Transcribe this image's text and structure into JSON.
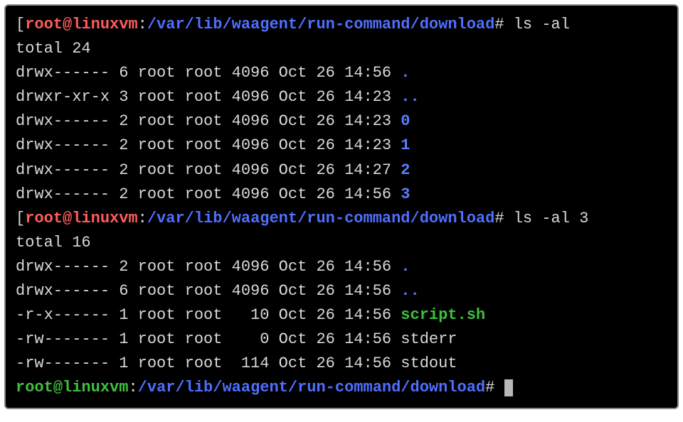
{
  "prompts": [
    {
      "user": "root",
      "at": "@",
      "host": "linuxvm",
      "colon": ":",
      "cwd": "/var/lib/waagent/run-command/download",
      "hash": "#",
      "cmd": "ls -al"
    },
    {
      "user": "root",
      "at": "@",
      "host": "linuxvm",
      "colon": ":",
      "cwd": "/var/lib/waagent/run-command/download",
      "hash": "#",
      "cmd": "ls -al 3"
    },
    {
      "user": "root",
      "at": "@",
      "host": "linuxvm",
      "colon": ":",
      "cwd": "/var/lib/waagent/run-command/download",
      "hash": "#",
      "cmd": ""
    }
  ],
  "bracket_open": "[",
  "bracket_close": "]",
  "listing1": {
    "total": "total 24",
    "rows": [
      {
        "perms": "drwx------",
        "links": "6",
        "owner": "root",
        "group": "root",
        "size": "4096",
        "date": "Oct 26 14:56",
        "name": ".",
        "nclass": "blue"
      },
      {
        "perms": "drwxr-xr-x",
        "links": "3",
        "owner": "root",
        "group": "root",
        "size": "4096",
        "date": "Oct 26 14:23",
        "name": "..",
        "nclass": "blue"
      },
      {
        "perms": "drwx------",
        "links": "2",
        "owner": "root",
        "group": "root",
        "size": "4096",
        "date": "Oct 26 14:23",
        "name": "0",
        "nclass": "blue"
      },
      {
        "perms": "drwx------",
        "links": "2",
        "owner": "root",
        "group": "root",
        "size": "4096",
        "date": "Oct 26 14:23",
        "name": "1",
        "nclass": "blue"
      },
      {
        "perms": "drwx------",
        "links": "2",
        "owner": "root",
        "group": "root",
        "size": "4096",
        "date": "Oct 26 14:27",
        "name": "2",
        "nclass": "blue"
      },
      {
        "perms": "drwx------",
        "links": "2",
        "owner": "root",
        "group": "root",
        "size": "4096",
        "date": "Oct 26 14:56",
        "name": "3",
        "nclass": "blue"
      }
    ]
  },
  "listing2": {
    "total": "total 16",
    "rows": [
      {
        "perms": "drwx------",
        "links": "2",
        "owner": "root",
        "group": "root",
        "size": "4096",
        "date": "Oct 26 14:56",
        "name": ".",
        "nclass": "blue"
      },
      {
        "perms": "drwx------",
        "links": "6",
        "owner": "root",
        "group": "root",
        "size": "4096",
        "date": "Oct 26 14:56",
        "name": "..",
        "nclass": "blue"
      },
      {
        "perms": "-r-x------",
        "links": "1",
        "owner": "root",
        "group": "root",
        "size": "10",
        "date": "Oct 26 14:56",
        "name": "script.sh",
        "nclass": "exec"
      },
      {
        "perms": "-rw-------",
        "links": "1",
        "owner": "root",
        "group": "root",
        "size": "0",
        "date": "Oct 26 14:56",
        "name": "stderr",
        "nclass": "dim"
      },
      {
        "perms": "-rw-------",
        "links": "1",
        "owner": "root",
        "group": "root",
        "size": "114",
        "date": "Oct 26 14:56",
        "name": "stdout",
        "nclass": "dim"
      }
    ]
  }
}
